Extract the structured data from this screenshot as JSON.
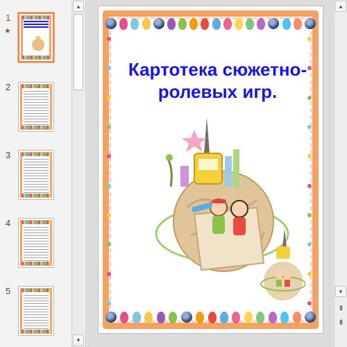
{
  "slide_title_lines": [
    "Картотека сюжетно-",
    "ролевых игр."
  ],
  "thumbnails": [
    {
      "number": "1",
      "active": true,
      "has_star": true
    },
    {
      "number": "2",
      "active": false,
      "has_star": false
    },
    {
      "number": "3",
      "active": false,
      "has_star": false
    },
    {
      "number": "4",
      "active": false,
      "has_star": false
    },
    {
      "number": "5",
      "active": false,
      "has_star": false
    }
  ],
  "icons": {
    "star": "★",
    "up": "▲",
    "down": "▼",
    "prev_slide": "⇞",
    "next_slide": "⇟"
  },
  "colors": {
    "title": "#1515e6",
    "frame": "#f5a161",
    "selected_thumb": "#e8834a"
  }
}
